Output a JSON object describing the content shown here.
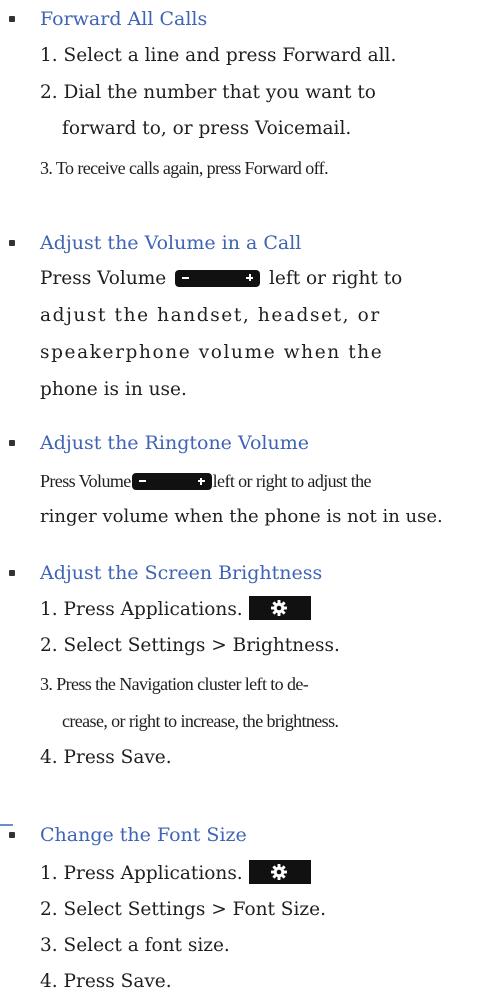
{
  "sections": {
    "forward": {
      "heading": "Forward All Calls",
      "steps": [
        "1. Select a line and press Forward all.",
        "2. Dial the number that you want to",
        "forward to, or press Voicemail.",
        "3. To receive calls again, press Forward off."
      ]
    },
    "volume_call": {
      "heading": "Adjust the Volume in a Call",
      "line1_before": "Press Volume",
      "line1_after": "left or right to",
      "line2": "adjust the handset, headset, or",
      "line3": "speakerphone volume when the",
      "line4": "phone is in use."
    },
    "ringtone": {
      "heading": "Adjust the Ringtone Volume",
      "line1_before": "Press Volume",
      "line1_after": "left or right to adjust the",
      "line2": "ringer volume when the phone is not in use."
    },
    "brightness": {
      "heading": "Adjust the Screen Brightness",
      "step1": "1. Press Applications.",
      "step2": "2. Select Settings > Brightness.",
      "step3a": "3. Press the Navigation cluster left to de-",
      "step3b": "crease, or right to increase, the brightness.",
      "step4": "4. Press Save."
    },
    "font_size": {
      "heading": "Change the Font Size",
      "step1": "1. Press Applications.",
      "step2": "2. Select Settings > Font Size.",
      "step3": "3. Select a font size.",
      "step4": "4. Press Save."
    }
  },
  "icons": {
    "volume_key": "volume-rocker-icon",
    "applications_key": "applications-gear-icon"
  },
  "colors": {
    "heading": "#3f63b5",
    "body_text": "#1f1f1f",
    "key_fill": "#111111"
  }
}
